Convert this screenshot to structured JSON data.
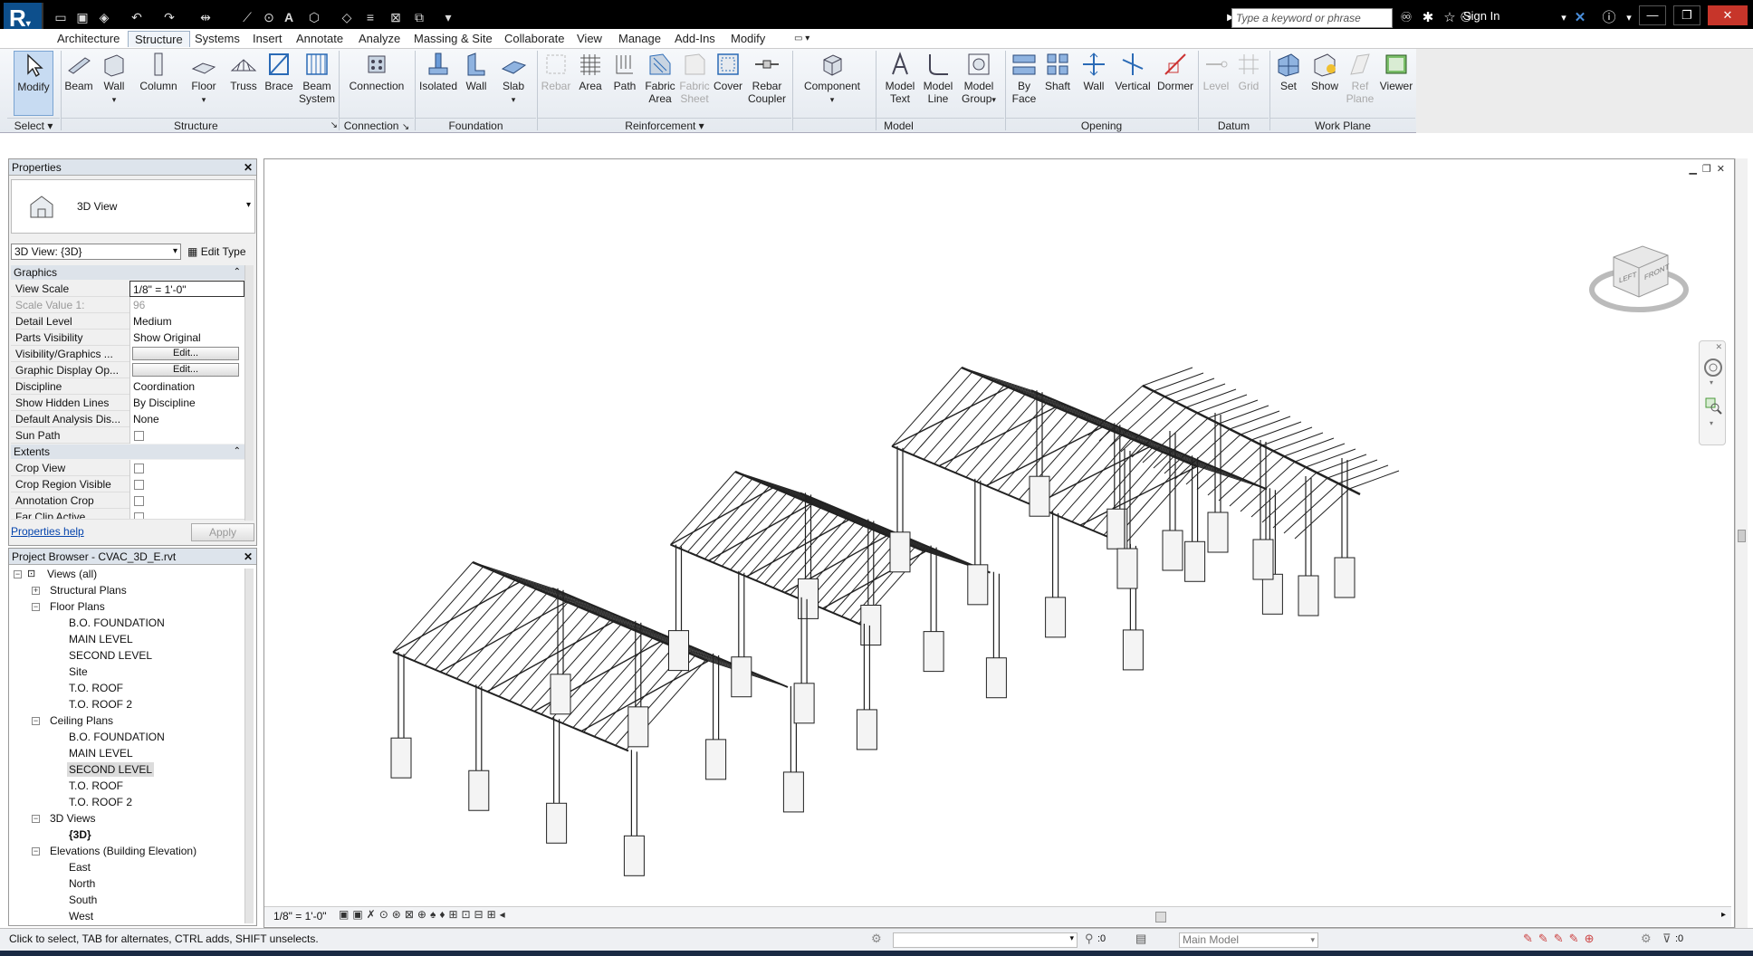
{
  "titlebar": {
    "search_placeholder": "Type a keyword or phrase",
    "sign_in": "Sign In"
  },
  "tabs": [
    "Architecture",
    "Structure",
    "Systems",
    "Insert",
    "Annotate",
    "Analyze",
    "Massing & Site",
    "Collaborate",
    "View",
    "Manage",
    "Add-Ins",
    "Modify"
  ],
  "active_tab": "Structure",
  "ribbon": {
    "buttons": [
      {
        "id": "modify",
        "label": "Modify"
      },
      {
        "id": "beam",
        "label": "Beam"
      },
      {
        "id": "wall",
        "label": "Wall"
      },
      {
        "id": "column",
        "label": "Column"
      },
      {
        "id": "floor",
        "label": "Floor"
      },
      {
        "id": "truss",
        "label": "Truss"
      },
      {
        "id": "brace",
        "label": "Brace"
      },
      {
        "id": "beam_system",
        "label": "Beam System"
      },
      {
        "id": "connection",
        "label": "Connection"
      },
      {
        "id": "isolated",
        "label": "Isolated"
      },
      {
        "id": "wall_f",
        "label": "Wall"
      },
      {
        "id": "slab",
        "label": "Slab"
      },
      {
        "id": "rebar",
        "label": "Rebar"
      },
      {
        "id": "area",
        "label": "Area"
      },
      {
        "id": "path",
        "label": "Path"
      },
      {
        "id": "fabric_area",
        "label": "Fabric Area"
      },
      {
        "id": "fabric_sheet",
        "label": "Fabric Sheet"
      },
      {
        "id": "cover",
        "label": "Cover"
      },
      {
        "id": "rebar_coupler",
        "label": "Rebar Coupler"
      },
      {
        "id": "component",
        "label": "Component"
      },
      {
        "id": "model_text",
        "label": "Model Text"
      },
      {
        "id": "model_line",
        "label": "Model Line"
      },
      {
        "id": "model_group",
        "label": "Model Group"
      },
      {
        "id": "by_face",
        "label": "By Face"
      },
      {
        "id": "shaft",
        "label": "Shaft"
      },
      {
        "id": "wall_o",
        "label": "Wall"
      },
      {
        "id": "vertical",
        "label": "Vertical"
      },
      {
        "id": "dormer",
        "label": "Dormer"
      },
      {
        "id": "level",
        "label": "Level"
      },
      {
        "id": "grid",
        "label": "Grid"
      },
      {
        "id": "set",
        "label": "Set"
      },
      {
        "id": "show",
        "label": "Show"
      },
      {
        "id": "ref_plane",
        "label": "Ref Plane"
      },
      {
        "id": "viewer",
        "label": "Viewer"
      }
    ],
    "panels": {
      "select": "Select",
      "structure": "Structure",
      "connection": "Connection",
      "foundation": "Foundation",
      "reinforcement": "Reinforcement",
      "model": "Model",
      "opening": "Opening",
      "datum": "Datum",
      "work_plane": "Work Plane"
    }
  },
  "properties": {
    "title": "Properties",
    "type_name": "3D View",
    "view_selector": "3D View: {3D}",
    "edit_type": "Edit Type",
    "sections": {
      "graphics": "Graphics",
      "extents": "Extents"
    },
    "rows": [
      {
        "k": "View Scale",
        "v": "1/8\" = 1'-0\""
      },
      {
        "k": "Scale Value    1:",
        "v": "96"
      },
      {
        "k": "Detail Level",
        "v": "Medium"
      },
      {
        "k": "Parts Visibility",
        "v": "Show Original"
      },
      {
        "k": "Visibility/Graphics ...",
        "v": "Edit..."
      },
      {
        "k": "Graphic Display Op...",
        "v": "Edit..."
      },
      {
        "k": "Discipline",
        "v": "Coordination"
      },
      {
        "k": "Show Hidden Lines",
        "v": "By Discipline"
      },
      {
        "k": "Default Analysis Dis...",
        "v": "None"
      },
      {
        "k": "Sun Path",
        "v": ""
      }
    ],
    "extent_rows": [
      "Crop View",
      "Crop Region Visible",
      "Annotation Crop",
      "Far Clip Active"
    ],
    "help": "Properties help",
    "apply": "Apply"
  },
  "browser": {
    "title": "Project Browser - CVAC_3D_E.rvt",
    "items": [
      {
        "t": "Views (all)",
        "lvl": 0
      },
      {
        "t": "Structural Plans",
        "lvl": 1
      },
      {
        "t": "Floor Plans",
        "lvl": 1
      },
      {
        "t": "B.O. FOUNDATION",
        "lvl": 2
      },
      {
        "t": "MAIN LEVEL",
        "lvl": 2
      },
      {
        "t": "SECOND LEVEL",
        "lvl": 2
      },
      {
        "t": "Site",
        "lvl": 2
      },
      {
        "t": "T.O. ROOF",
        "lvl": 2
      },
      {
        "t": "T.O. ROOF 2",
        "lvl": 2
      },
      {
        "t": "Ceiling Plans",
        "lvl": 1
      },
      {
        "t": "B.O. FOUNDATION",
        "lvl": 2
      },
      {
        "t": "MAIN LEVEL",
        "lvl": 2
      },
      {
        "t": "SECOND LEVEL",
        "lvl": 2
      },
      {
        "t": "T.O. ROOF",
        "lvl": 2
      },
      {
        "t": "T.O. ROOF 2",
        "lvl": 2
      },
      {
        "t": "3D Views",
        "lvl": 1
      },
      {
        "t": "{3D}",
        "lvl": 2
      },
      {
        "t": "Elevations (Building Elevation)",
        "lvl": 1
      },
      {
        "t": "East",
        "lvl": 2
      },
      {
        "t": "North",
        "lvl": 2
      },
      {
        "t": "South",
        "lvl": 2
      },
      {
        "t": "West",
        "lvl": 2
      }
    ]
  },
  "viewcube": {
    "left": "LEFT",
    "front": "FRONT"
  },
  "viewctl": {
    "scale": "1/8\" = 1'-0\""
  },
  "status": {
    "hint": "Click to select, TAB for alternates, CTRL adds, SHIFT unselects.",
    "zero1": ":0",
    "model": "Main Model",
    "zero2": ":0"
  }
}
